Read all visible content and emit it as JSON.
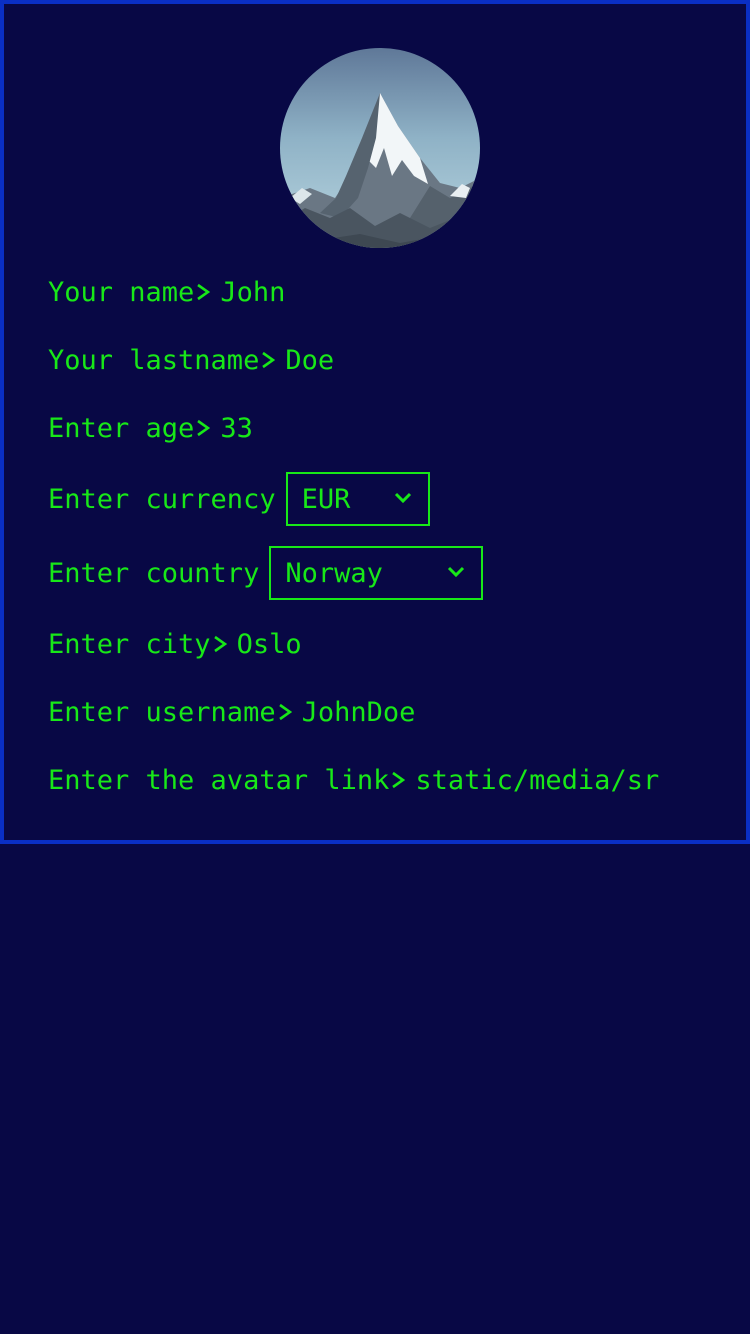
{
  "colors": {
    "background": "#080845",
    "border": "#0a2fc4",
    "text": "#18e818"
  },
  "avatar": {
    "icon": "mountain-avatar-image"
  },
  "form": {
    "name_label": "Your name",
    "name_value": "John",
    "lastname_label": "Your lastname",
    "lastname_value": "Doe",
    "age_label": "Enter age",
    "age_value": "33",
    "currency_label": "Enter currency",
    "currency_value": "EUR",
    "country_label": "Enter country",
    "country_value": "Norway",
    "city_label": "Enter city",
    "city_value": "Oslo",
    "username_label": "Enter username",
    "username_value": "JohnDoe",
    "avatar_label": "Enter the avatar link",
    "avatar_value": "static/media/sr"
  }
}
